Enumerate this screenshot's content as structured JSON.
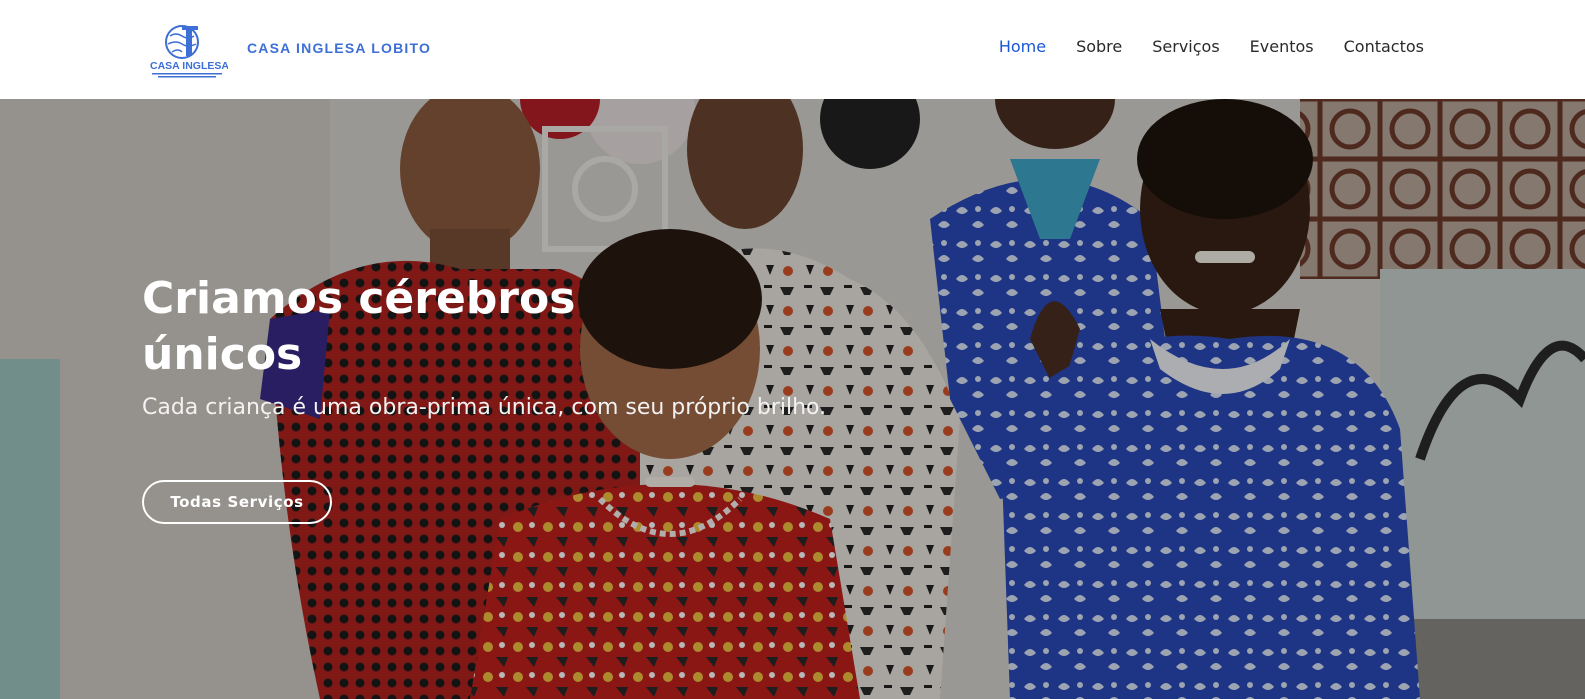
{
  "header": {
    "logo": {
      "icon": "casa-inglesa-logo-icon",
      "primary_color": "#3d6fd6"
    },
    "brand_name": "CASA INGLESA LOBITO",
    "nav": [
      {
        "label": "Home",
        "active": true
      },
      {
        "label": "Sobre",
        "active": false
      },
      {
        "label": "Serviços",
        "active": false
      },
      {
        "label": "Eventos",
        "active": false
      },
      {
        "label": "Contactos",
        "active": false
      }
    ],
    "colors": {
      "active": "#1a56d6",
      "text": "#2a2a2a"
    }
  },
  "hero": {
    "title": "Criamos cérebros únicos",
    "subtitle": "Cada criança é uma obra-prima única, com seu próprio brilho.",
    "cta_label": "Todas Serviços",
    "image_icon": "children-photo"
  }
}
